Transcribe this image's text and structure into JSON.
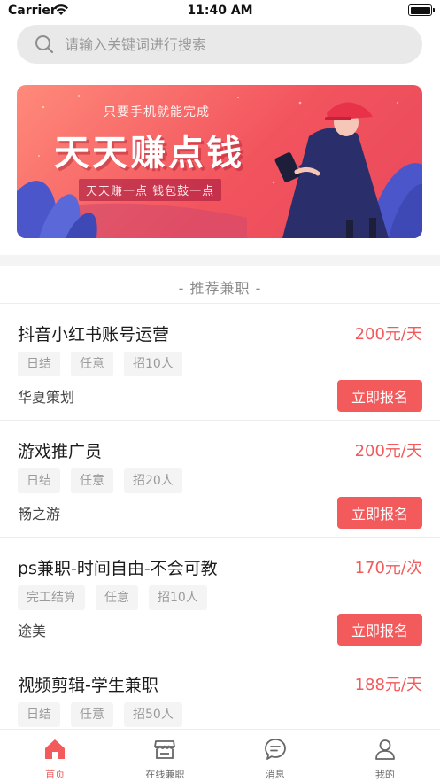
{
  "status_bar": {
    "carrier": "Carrier",
    "time": "11:40 AM"
  },
  "search": {
    "placeholder": "请输入关键词进行搜索"
  },
  "banner": {
    "subtitle": "只要手机就能完成",
    "title": "天天赚点钱",
    "tagline": "天天赚一点  钱包鼓一点"
  },
  "section_title": "- 推荐兼职 -",
  "jobs": [
    {
      "title": "抖音小红书账号运营",
      "salary": "200元/天",
      "tags": [
        "日结",
        "任意",
        "招10人"
      ],
      "company": "华夏策划",
      "button": "立即报名"
    },
    {
      "title": "游戏推广员",
      "salary": "200元/天",
      "tags": [
        "日结",
        "任意",
        "招20人"
      ],
      "company": "畅之游",
      "button": "立即报名"
    },
    {
      "title": "ps兼职-时间自由-不会可教",
      "salary": "170元/次",
      "tags": [
        "完工结算",
        "任意",
        "招10人"
      ],
      "company": "途美",
      "button": "立即报名"
    },
    {
      "title": "视频剪辑-学生兼职",
      "salary": "188元/天",
      "tags": [
        "日结",
        "任意",
        "招50人"
      ],
      "company": "",
      "button": ""
    }
  ],
  "tabs": [
    {
      "label": "首页",
      "icon": "home-icon",
      "active": true
    },
    {
      "label": "在线兼职",
      "icon": "shop-icon",
      "active": false
    },
    {
      "label": "消息",
      "icon": "chat-icon",
      "active": false
    },
    {
      "label": "我的",
      "icon": "user-icon",
      "active": false
    }
  ],
  "colors": {
    "accent": "#f25a5c",
    "banner_start": "#ff8a7a",
    "banner_end": "#e9485a"
  }
}
